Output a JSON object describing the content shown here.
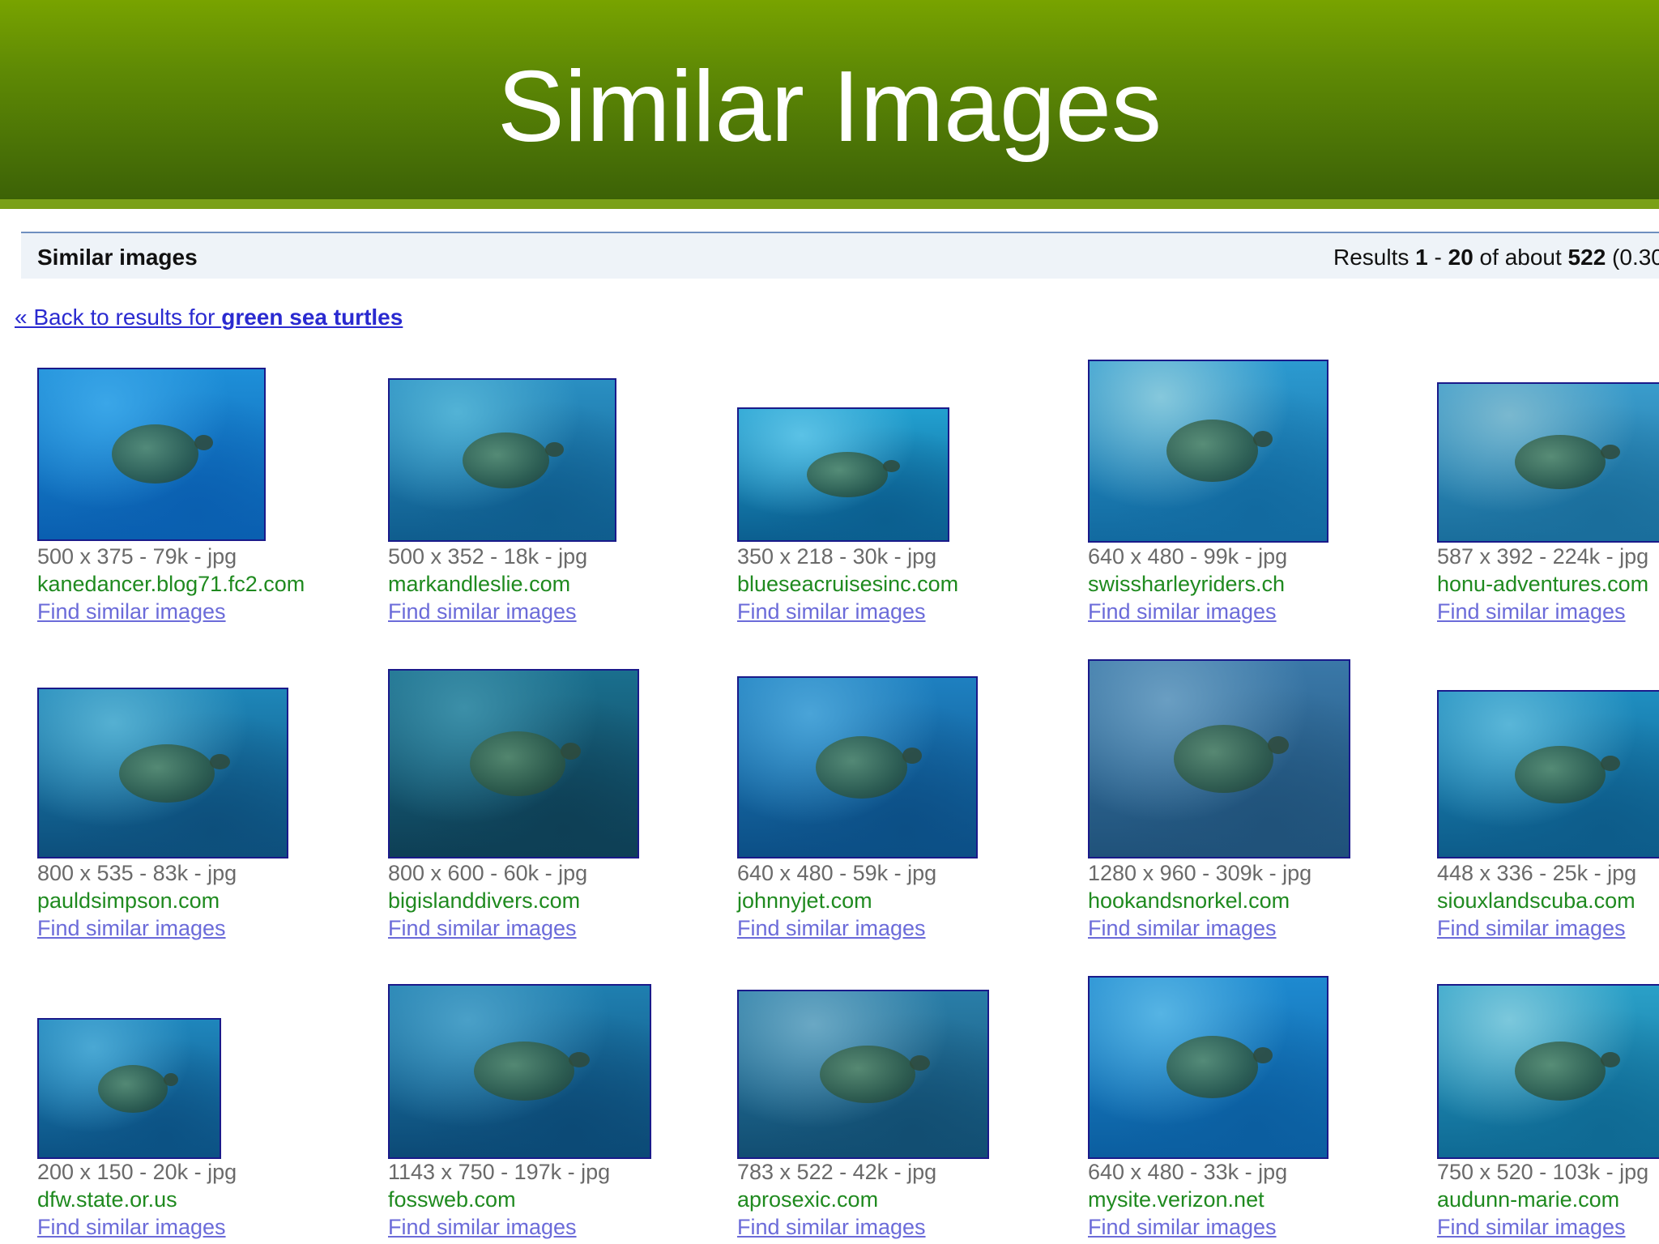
{
  "header": {
    "title": "Similar Images"
  },
  "results_bar": {
    "label": "Similar images",
    "stats_prefix": "Results ",
    "range_start": "1",
    "range_sep": " - ",
    "range_end": "20",
    "of_about": " of about ",
    "total": "522",
    "time": " (0.30"
  },
  "back_link": {
    "prefix": "« Back to results for ",
    "query": "green sea turtles"
  },
  "images": [
    {
      "dims": "500 x 375 - 79k - jpg",
      "site": "kanedancer.blog71.fc2.com",
      "link": "Find similar images",
      "colors": [
        "#1e8fd8",
        "#0a5fb0",
        "#3aa6e8"
      ]
    },
    {
      "dims": "500 x 352 - 18k - jpg",
      "site": "markandleslie.com",
      "link": "Find similar images",
      "colors": [
        "#2a8fc2",
        "#0f5d8e",
        "#53b3d6"
      ]
    },
    {
      "dims": "350 x 218 - 30k - jpg",
      "site": "blueseacruisesinc.com",
      "link": "Find similar images",
      "colors": [
        "#22a0d0",
        "#0b5f90",
        "#5bc2e6"
      ]
    },
    {
      "dims": "640 x 480 - 99k - jpg",
      "site": "swissharleyriders.ch",
      "link": "Find similar images",
      "colors": [
        "#2c9ad0",
        "#126aa0",
        "#86c8dc"
      ]
    },
    {
      "dims": "587 x 392 - 224k - jpg",
      "site": "honu-adventures.com",
      "link": "Find similar images",
      "colors": [
        "#3a9ccc",
        "#1a6e9c",
        "#7ab8cf"
      ]
    },
    {
      "dims": "800 x 535 - 83k - jpg",
      "site": "pauldsimpson.com",
      "link": "Find similar images",
      "colors": [
        "#1e86b8",
        "#0d4f7c",
        "#55b0d2"
      ]
    },
    {
      "dims": "800 x 600 - 60k - jpg",
      "site": "bigislanddivers.com",
      "link": "Find similar images",
      "colors": [
        "#1a6f8e",
        "#0e3f55",
        "#3c8fa8"
      ]
    },
    {
      "dims": "640 x 480 - 59k - jpg",
      "site": "johnnyjet.com",
      "link": "Find similar images",
      "colors": [
        "#1e80c0",
        "#0c4f86",
        "#4aa4d8"
      ]
    },
    {
      "dims": "1280 x 960 - 309k - jpg",
      "site": "hookandsnorkel.com",
      "link": "Find similar images",
      "colors": [
        "#3a78a8",
        "#20527a",
        "#6a9ec2"
      ]
    },
    {
      "dims": "448 x 336 - 25k - jpg",
      "site": "siouxlandscuba.com",
      "link": "Find similar images",
      "colors": [
        "#1f8ec0",
        "#0d5c8a",
        "#5ab6d8"
      ]
    },
    {
      "dims": "200 x 150 - 20k - jpg",
      "site": "dfw.state.or.us",
      "link": "Find similar images",
      "colors": [
        "#1f86bc",
        "#0c5284",
        "#4aa8d4"
      ]
    },
    {
      "dims": "1143 x 750 - 197k - jpg",
      "site": "fossweb.com",
      "link": "Find similar images",
      "colors": [
        "#1f7fb0",
        "#0c4a76",
        "#4aa0c8"
      ]
    },
    {
      "dims": "783 x 522 - 42k - jpg",
      "site": "aprosexic.com",
      "link": "Find similar images",
      "colors": [
        "#2a7ea8",
        "#124e72",
        "#6aa8c4"
      ]
    },
    {
      "dims": "640 x 480 - 33k - jpg",
      "site": "mysite.verizon.net",
      "link": "Find similar images",
      "colors": [
        "#1e8ad0",
        "#0b5ea0",
        "#56b4e4"
      ]
    },
    {
      "dims": "750 x 520 - 103k - jpg",
      "site": "audunn-marie.com",
      "link": "Find similar images",
      "colors": [
        "#2aa0c8",
        "#0f6a94",
        "#7cc8dc"
      ]
    }
  ]
}
